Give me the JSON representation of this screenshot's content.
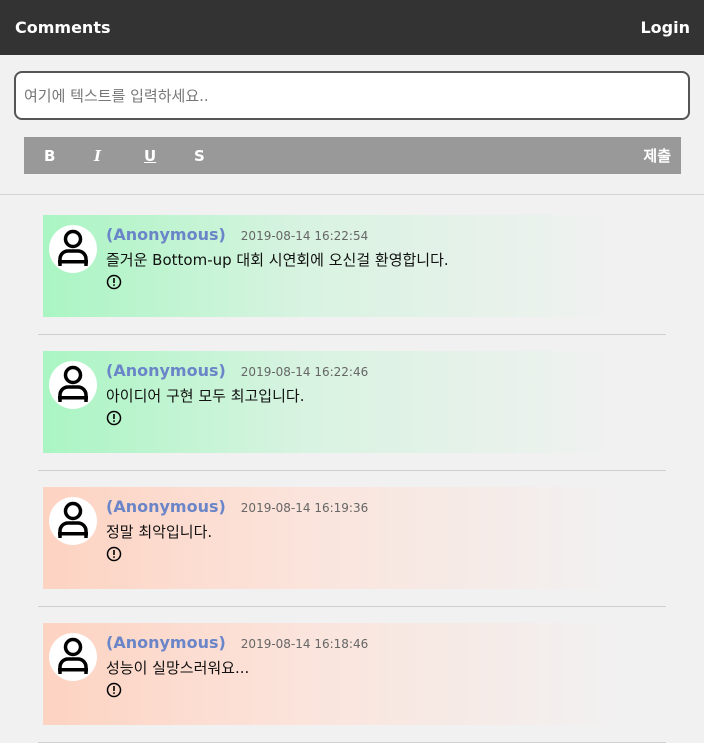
{
  "header": {
    "title": "Comments",
    "login_label": "Login"
  },
  "editor": {
    "placeholder": "여기에 텍스트를 입력하세요..",
    "value": "",
    "bold_label": "B",
    "italic_label": "I",
    "underline_label": "U",
    "strike_label": "S",
    "submit_label": "제출"
  },
  "comments": [
    {
      "author": "(Anonymous)",
      "time": "2019-08-14 16:22:54",
      "text": "즐거운 Bottom-up 대회 시연회에 오신걸 환영합니다.",
      "sentiment": "positive",
      "color": "#aaf5c3"
    },
    {
      "author": "(Anonymous)",
      "time": "2019-08-14 16:22:46",
      "text": "아이디어 구현 모두 최고입니다.",
      "sentiment": "positive",
      "color": "#aaf5c3"
    },
    {
      "author": "(Anonymous)",
      "time": "2019-08-14 16:19:36",
      "text": "정말 최악입니다.",
      "sentiment": "negative",
      "color": "#fdd3c2"
    },
    {
      "author": "(Anonymous)",
      "time": "2019-08-14 16:18:46",
      "text": "성능이 실망스러워요...",
      "sentiment": "negative",
      "color": "#fdd3c2"
    }
  ],
  "icons": {
    "avatar": "user-avatar-icon",
    "report": "report-alert-icon"
  }
}
